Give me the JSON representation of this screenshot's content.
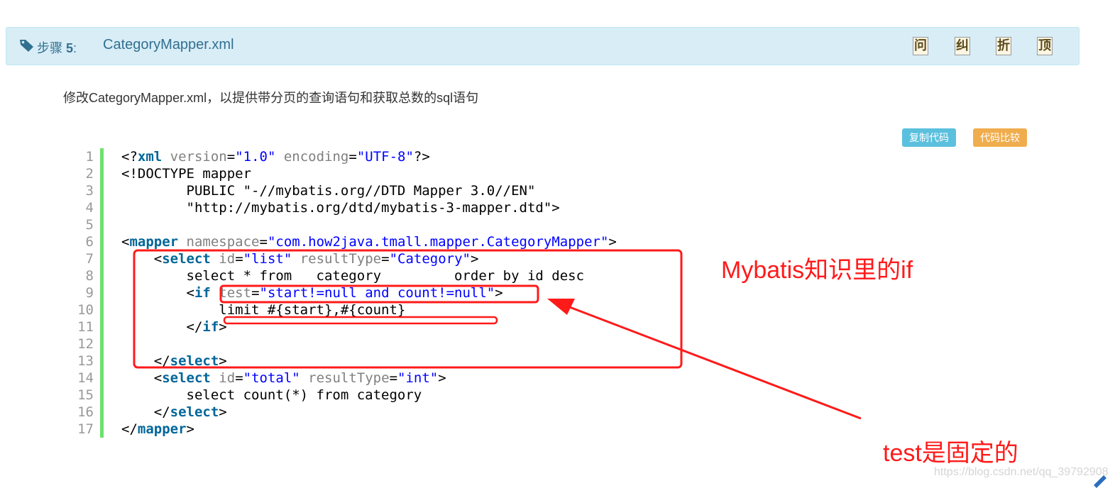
{
  "step": {
    "label": "步骤",
    "number": "5",
    "separator": ":",
    "title": "CategoryMapper.xml",
    "buttons": [
      "问",
      "纠",
      "折",
      "顶"
    ]
  },
  "description": "修改CategoryMapper.xml，以提供带分页的查询语句和获取总数的sql语句",
  "actions": {
    "copy_label": "复制代码",
    "compare_label": "代码比较"
  },
  "code": {
    "line_numbers": [
      "1",
      "2",
      "3",
      "4",
      "5",
      "6",
      "7",
      "8",
      "9",
      "10",
      "11",
      "12",
      "13",
      "14",
      "15",
      "16",
      "17"
    ],
    "lines": [
      [
        {
          "t": "<?",
          "c": ""
        },
        {
          "t": "xml",
          "c": "kw"
        },
        {
          "t": " ",
          "c": ""
        },
        {
          "t": "version",
          "c": "at"
        },
        {
          "t": "=",
          "c": ""
        },
        {
          "t": "\"1.0\"",
          "c": "st"
        },
        {
          "t": " ",
          "c": ""
        },
        {
          "t": "encoding",
          "c": "at"
        },
        {
          "t": "=",
          "c": ""
        },
        {
          "t": "\"UTF-8\"",
          "c": "st"
        },
        {
          "t": "?>",
          "c": ""
        }
      ],
      [
        {
          "t": "<!DOCTYPE mapper",
          "c": ""
        }
      ],
      [
        {
          "t": "        PUBLIC \"-//mybatis.org//DTD Mapper 3.0//EN\"",
          "c": ""
        }
      ],
      [
        {
          "t": "        \"http://mybatis.org/dtd/mybatis-3-mapper.dtd\">",
          "c": ""
        }
      ],
      [
        {
          "t": "",
          "c": ""
        }
      ],
      [
        {
          "t": "<",
          "c": ""
        },
        {
          "t": "mapper",
          "c": "kw"
        },
        {
          "t": " ",
          "c": ""
        },
        {
          "t": "namespace",
          "c": "at"
        },
        {
          "t": "=",
          "c": ""
        },
        {
          "t": "\"com.how2java.tmall.mapper.CategoryMapper\"",
          "c": "st"
        },
        {
          "t": ">",
          "c": ""
        }
      ],
      [
        {
          "t": "    <",
          "c": ""
        },
        {
          "t": "select",
          "c": "kw"
        },
        {
          "t": " ",
          "c": ""
        },
        {
          "t": "id",
          "c": "at"
        },
        {
          "t": "=",
          "c": ""
        },
        {
          "t": "\"list\"",
          "c": "st"
        },
        {
          "t": " ",
          "c": ""
        },
        {
          "t": "resultType",
          "c": "at"
        },
        {
          "t": "=",
          "c": ""
        },
        {
          "t": "\"Category\"",
          "c": "st"
        },
        {
          "t": ">",
          "c": ""
        }
      ],
      [
        {
          "t": "        select * from   category         order by id desc",
          "c": ""
        }
      ],
      [
        {
          "t": "        <",
          "c": ""
        },
        {
          "t": "if",
          "c": "kw"
        },
        {
          "t": " ",
          "c": ""
        },
        {
          "t": "test",
          "c": "at"
        },
        {
          "t": "=",
          "c": ""
        },
        {
          "t": "\"start!=null and count!=null\"",
          "c": "st"
        },
        {
          "t": ">",
          "c": ""
        }
      ],
      [
        {
          "t": "            limit #{start},#{count}",
          "c": ""
        }
      ],
      [
        {
          "t": "        </",
          "c": ""
        },
        {
          "t": "if",
          "c": "kw"
        },
        {
          "t": ">",
          "c": ""
        }
      ],
      [
        {
          "t": "",
          "c": ""
        }
      ],
      [
        {
          "t": "    </",
          "c": ""
        },
        {
          "t": "select",
          "c": "kw"
        },
        {
          "t": ">",
          "c": ""
        }
      ],
      [
        {
          "t": "    <",
          "c": ""
        },
        {
          "t": "select",
          "c": "kw"
        },
        {
          "t": " ",
          "c": ""
        },
        {
          "t": "id",
          "c": "at"
        },
        {
          "t": "=",
          "c": ""
        },
        {
          "t": "\"total\"",
          "c": "st"
        },
        {
          "t": " ",
          "c": ""
        },
        {
          "t": "resultType",
          "c": "at"
        },
        {
          "t": "=",
          "c": ""
        },
        {
          "t": "\"int\"",
          "c": "st"
        },
        {
          "t": ">",
          "c": ""
        }
      ],
      [
        {
          "t": "        select count(*) from category",
          "c": ""
        }
      ],
      [
        {
          "t": "    </",
          "c": ""
        },
        {
          "t": "select",
          "c": "kw"
        },
        {
          "t": ">",
          "c": ""
        }
      ],
      [
        {
          "t": "</",
          "c": ""
        },
        {
          "t": "mapper",
          "c": "kw"
        },
        {
          "t": ">",
          "c": ""
        }
      ]
    ]
  },
  "annotations": {
    "if_note": "Mybatis知识里的if",
    "test_note": "test是固定的",
    "color": "#ff1a1a"
  },
  "watermark": "https://blog.csdn.net/qq_39792908",
  "colors": {
    "header_bg": "#d9edf7",
    "header_text": "#31708f",
    "gutter": "#6ce26c",
    "copy_button": "#5bc0de",
    "compare_button": "#f0ad4e"
  }
}
